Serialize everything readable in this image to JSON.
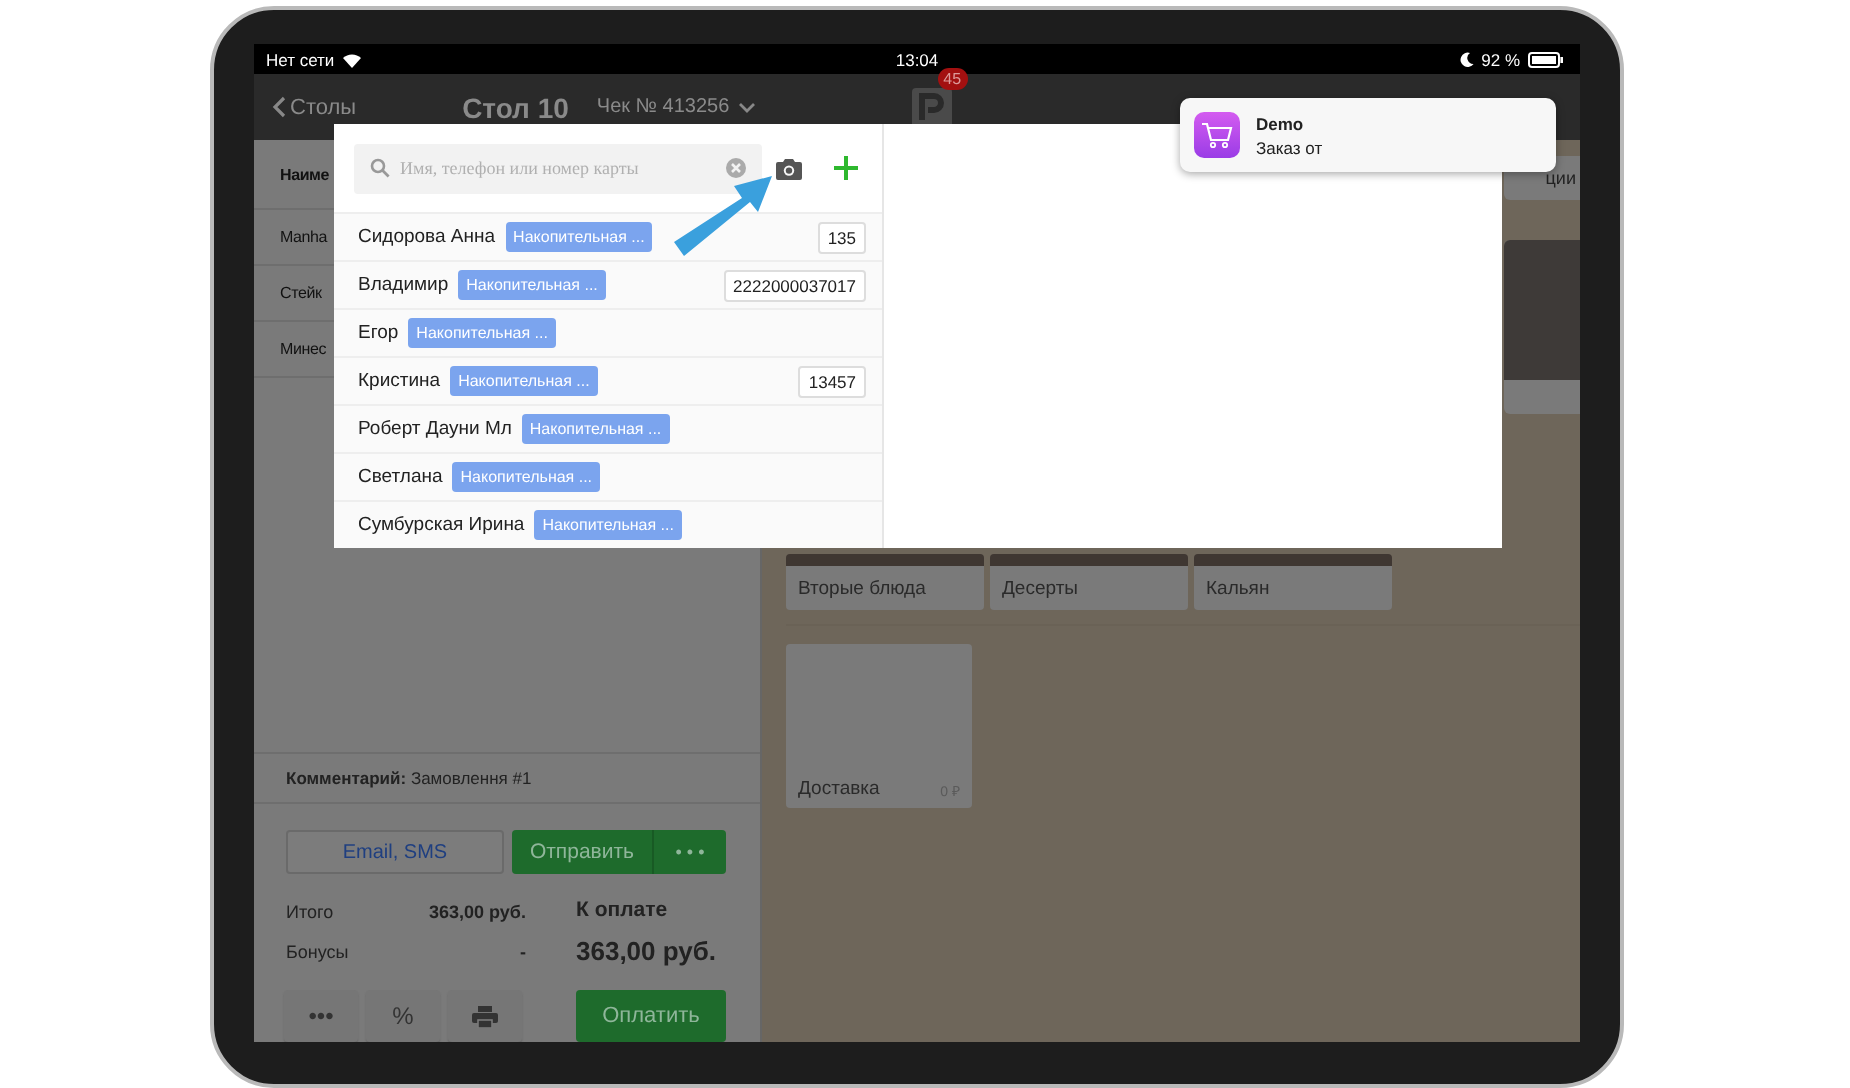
{
  "status_bar": {
    "carrier": "Нет сети",
    "time": "13:04",
    "battery": "92 %"
  },
  "nav": {
    "back": "Столы",
    "table": "Стол 10",
    "check": "Чек № 413256",
    "badge": "45"
  },
  "order_panel": {
    "header": "Наиме",
    "items": [
      "Manha",
      "Стейк",
      "Минес"
    ],
    "comment": "**Комментарий:** Замовлення #1",
    "email_button": "Email, SMS",
    "send_button": "Отправить",
    "more_button": "• • •",
    "totals": [
      {
        "label": "Итого",
        "value": "363,00 руб."
      },
      {
        "label": "Бонусы",
        "value": "-"
      }
    ],
    "due_label": "К оплате",
    "due_value": "363,00 руб.",
    "tool_buttons": [
      {
        "kind": "text",
        "label": "•••"
      },
      {
        "kind": "text",
        "label": "%"
      },
      {
        "kind": "print"
      }
    ],
    "pay_button": "Оплатить"
  },
  "categories": {
    "side_tile": "ции",
    "tiles": [
      "Вторые блюда",
      "Десерты",
      "Кальян"
    ],
    "delivery": {
      "label": "Доставка",
      "price": "0 ₽"
    }
  },
  "client_picker": {
    "search": {
      "placeholder": "Имя, телефон или номер карты"
    },
    "clients": [
      {
        "name": "Сидорова Анна",
        "tag": "Накопительная ...",
        "card": "135"
      },
      {
        "name": "Владимир",
        "tag": "Накопительная ...",
        "card": "2222000037017"
      },
      {
        "name": "Егор",
        "tag": "Накопительная ..."
      },
      {
        "name": "Кристина",
        "tag": "Накопительная ...",
        "card": "13457"
      },
      {
        "name": "Роберт Дауни Мл",
        "tag": "Накопительная ..."
      },
      {
        "name": "Светлана",
        "tag": "Накопительная ..."
      },
      {
        "name": "Сумбурская Ирина",
        "tag": "Накопительная ..."
      }
    ]
  },
  "notification": {
    "app": "Demo",
    "text": "Заказ от"
  }
}
